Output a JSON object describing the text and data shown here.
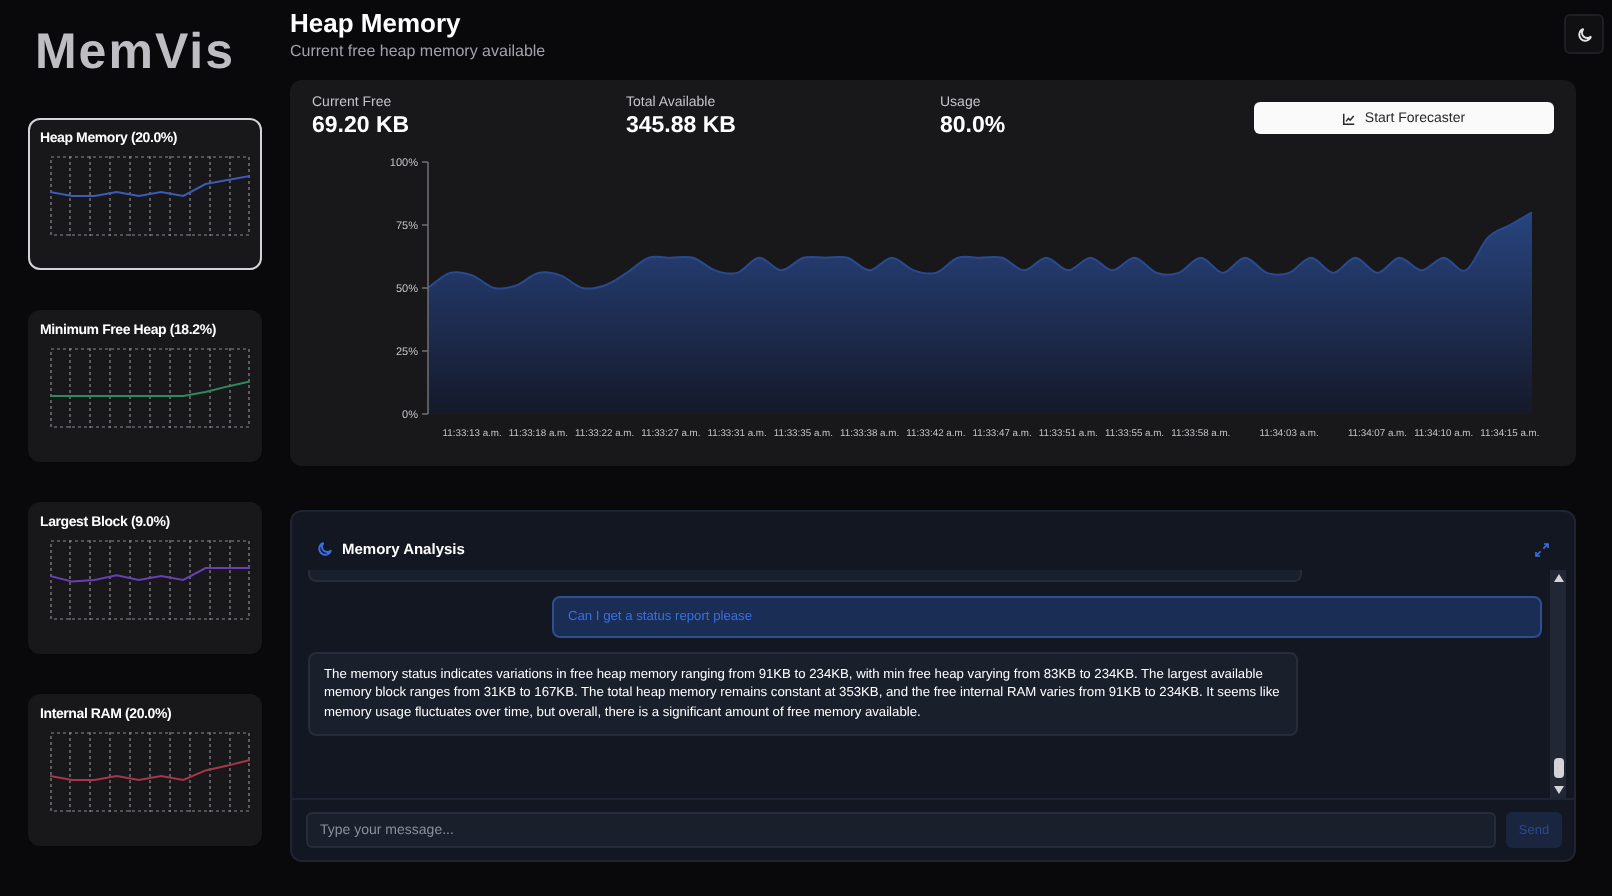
{
  "logo": "MemVis",
  "sidebar": {
    "cards": [
      {
        "title": "Heap Memory (20.0%)",
        "selected": true,
        "color": "#3b5bb5"
      },
      {
        "title": "Minimum Free Heap (18.2%)",
        "selected": false,
        "color": "#2f8a5a"
      },
      {
        "title": "Largest Block (9.0%)",
        "selected": false,
        "color": "#6a3fb5"
      },
      {
        "title": "Internal RAM (20.0%)",
        "selected": false,
        "color": "#a8354a"
      }
    ]
  },
  "header": {
    "title": "Heap Memory",
    "subtitle": "Current free heap memory available"
  },
  "stats": [
    {
      "label": "Current Free",
      "value": "69.20 KB"
    },
    {
      "label": "Total Available",
      "value": "345.88 KB"
    },
    {
      "label": "Usage",
      "value": "80.0%"
    }
  ],
  "forecast_button": "Start Forecaster",
  "chart_data": {
    "type": "area",
    "categories": [
      null,
      null,
      "11:33:13 a.m.",
      null,
      null,
      "11:33:18 a.m.",
      null,
      null,
      "11:33:22 a.m.",
      null,
      null,
      "11:33:27 a.m.",
      null,
      null,
      "11:33:31 a.m.",
      null,
      null,
      "11:33:35 a.m.",
      null,
      null,
      "11:33:38 a.m.",
      null,
      null,
      "11:33:42 a.m.",
      null,
      null,
      "11:33:47 a.m.",
      null,
      null,
      "11:33:51 a.m.",
      null,
      null,
      "11:33:55 a.m.",
      null,
      null,
      "11:33:58 a.m.",
      null,
      null,
      null,
      "11:34:03 a.m.",
      null,
      null,
      null,
      "11:34:07 a.m.",
      null,
      null,
      "11:34:10 a.m.",
      null,
      null,
      "11:34:15 a.m.",
      null
    ],
    "series": [
      {
        "color": "#2a4a8f",
        "values": [
          50,
          56,
          55,
          50,
          51,
          56,
          55,
          50,
          51,
          56,
          62,
          62,
          62,
          57,
          56,
          62,
          57,
          62,
          62,
          62,
          57,
          62,
          57,
          56,
          62,
          62,
          62,
          57,
          62,
          57,
          62,
          57,
          62,
          56,
          56,
          62,
          56,
          62,
          56,
          56,
          62,
          56,
          62,
          56,
          62,
          57,
          62,
          57,
          70,
          75,
          80
        ]
      }
    ],
    "ylim": [
      0,
      100
    ],
    "yticks": [
      {
        "value": 0,
        "label": "0%"
      },
      {
        "value": 25,
        "label": "25%"
      },
      {
        "value": 50,
        "label": "50%"
      },
      {
        "value": 75,
        "label": "75%"
      },
      {
        "value": 100,
        "label": "100%"
      }
    ]
  },
  "analysis": {
    "title": "Memory Analysis",
    "messages": [
      {
        "kind": "assistant-cut"
      },
      {
        "kind": "user",
        "text": "Can I get a status report please"
      },
      {
        "kind": "assistant",
        "text": "The memory status indicates variations in free heap memory ranging from 91KB to 234KB, with min free heap varying from 83KB to 234KB. The largest available memory block ranges from 31KB to 167KB. The total heap memory remains constant at 353KB, and the free internal RAM varies from 91KB to 234KB. It seems like memory usage fluctuates over time, but overall, there is a significant amount of free memory available."
      }
    ],
    "input": {
      "placeholder": "Type your message..."
    },
    "send_button": "Send"
  }
}
